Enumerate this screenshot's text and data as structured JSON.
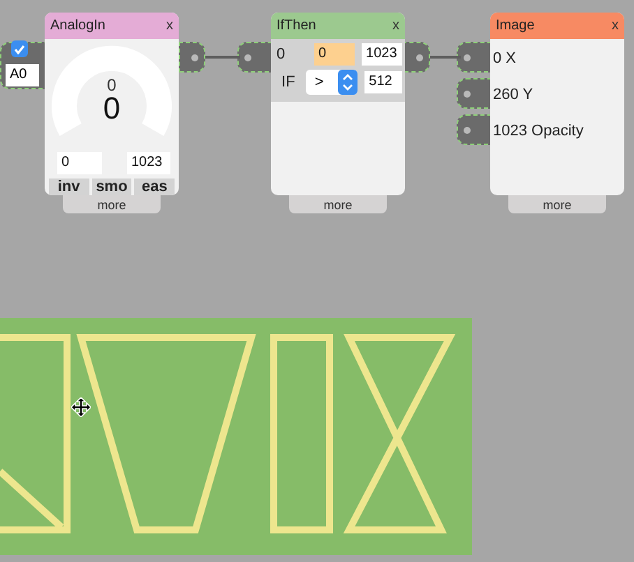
{
  "nodes": [
    {
      "kind": "analog",
      "title": "AnalogIn",
      "close": "x",
      "color": "#e4acd6",
      "input": {
        "checked": true,
        "value": "A0"
      },
      "reading_small": "0",
      "reading_big": "0",
      "min": "0",
      "max": "1023",
      "buttons": [
        "inv",
        "smo",
        "eas"
      ],
      "more": "more"
    },
    {
      "kind": "ifthen",
      "title": "IfThen",
      "close": "x",
      "color": "#9cc98f",
      "value": "0",
      "threshold_low": "0",
      "threshold_high": "1023",
      "condition_label": "IF",
      "operator": ">",
      "compare": "512",
      "more": "more"
    },
    {
      "title": "Image",
      "close": "x",
      "color": "#f78a63",
      "inputs": [
        "0 X",
        "260 Y",
        "1023 Opacity"
      ],
      "more": "more"
    }
  ]
}
